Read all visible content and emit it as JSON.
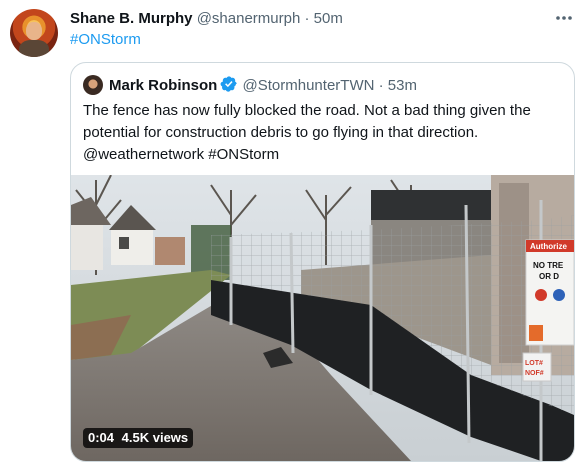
{
  "tweet": {
    "author_name": "Shane B. Murphy",
    "handle": "@shanermurph",
    "separator": "·",
    "time": "50m",
    "text": "#ONStorm",
    "more_icon": "ellipsis-icon"
  },
  "quoted": {
    "author_name": "Mark Robinson",
    "verified_icon": "verified-badge-icon",
    "handle": "@StormhunterTWN",
    "separator": "·",
    "time": "53m",
    "text_line1": "The fence has now fully blocked the road. Not a bad thing given the",
    "text_line2": "potential for construction debris to go flying in that direction.",
    "text_line3": "@weathernetwork #ONStorm",
    "video": {
      "duration": "0:04",
      "views": "4.5K views",
      "sign_lines": [
        "Authorize",
        "NO TRE",
        "OR D",
        "LOT#",
        "NOF#"
      ]
    }
  },
  "colors": {
    "link": "#1d9bf0",
    "muted": "#536471",
    "verified": "#1d9bf0",
    "border": "#cfd9de"
  }
}
